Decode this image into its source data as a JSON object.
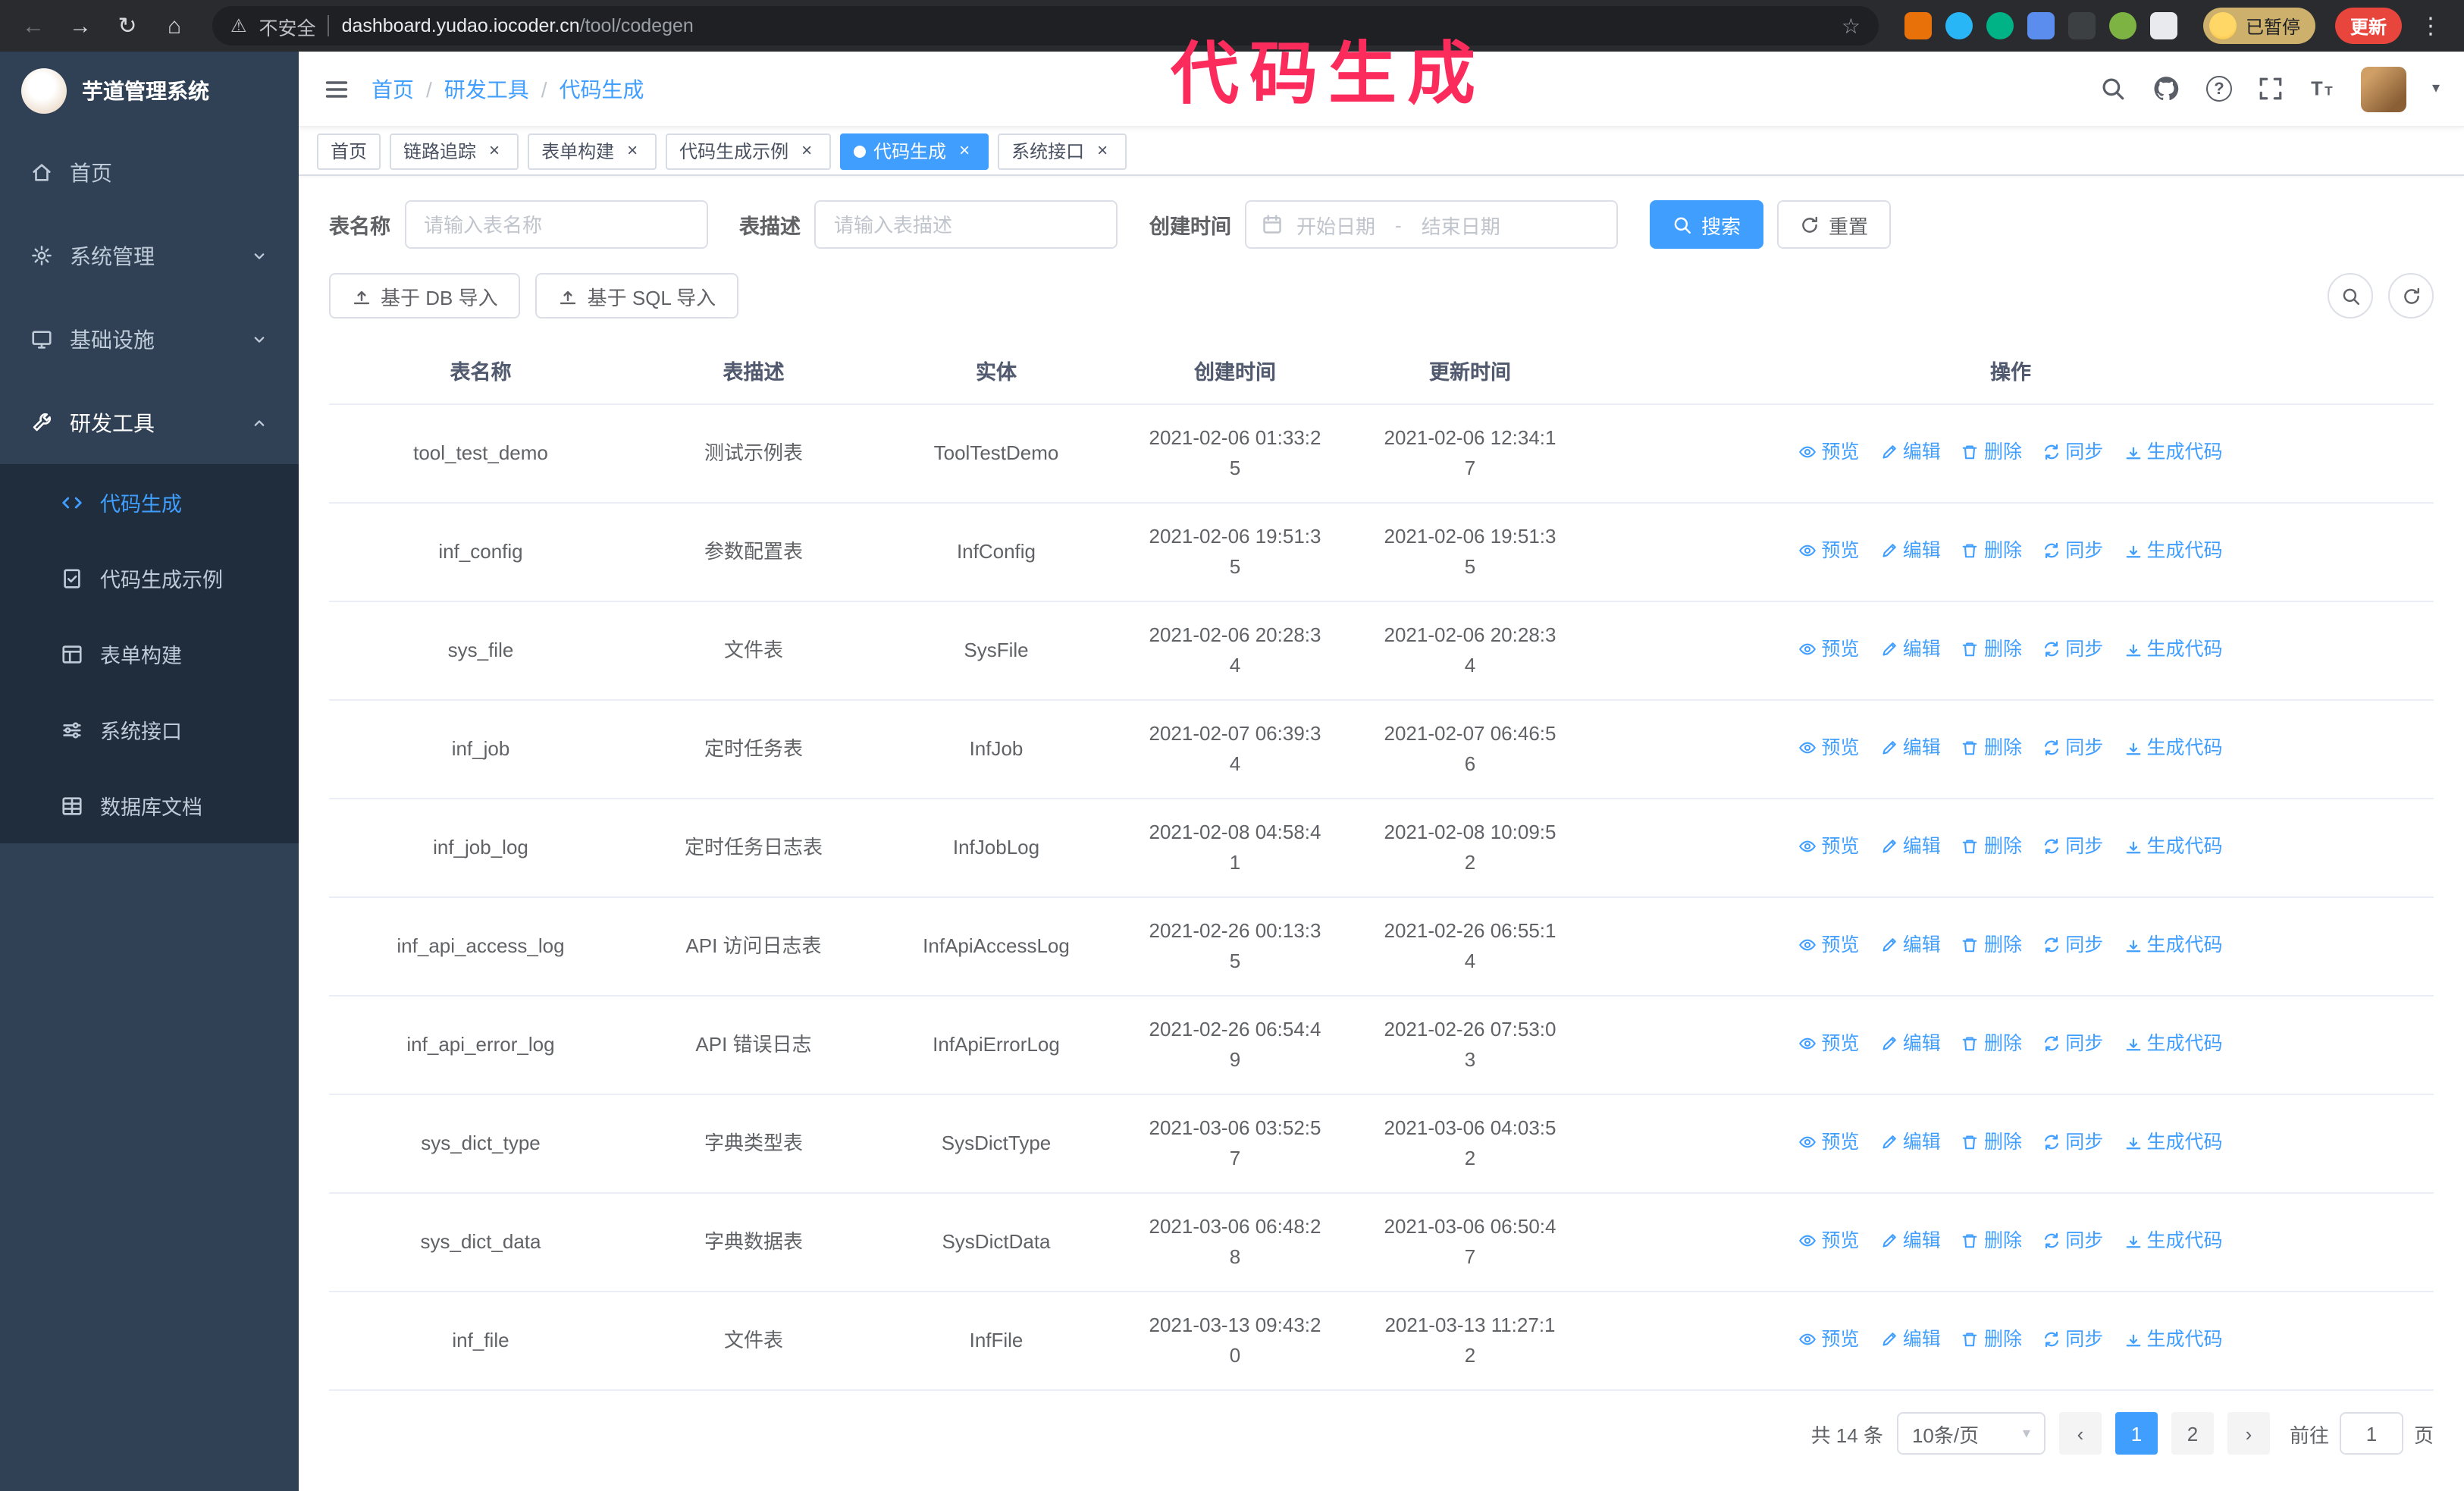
{
  "annotation": {
    "text": "代码生成",
    "color": "#fb2c5c"
  },
  "browser": {
    "insecure_label": "不安全",
    "url_domain": "dashboard.yudao.iocoder.cn",
    "url_path": "/tool/codegen",
    "paused_badge": "已暂停",
    "update_button": "更新"
  },
  "icons": {
    "back": "←",
    "forward": "→",
    "reload": "↻",
    "home": "⌂",
    "warning": "⚠",
    "star": "☆",
    "menu": "⋮",
    "close": "×",
    "caret_down": "▾",
    "question": "?",
    "prev": "‹",
    "next": "›",
    "breadcrumb_sep": "/"
  },
  "sidebar": {
    "logo_title": "芋道管理系统",
    "items": [
      {
        "label": "首页"
      },
      {
        "label": "系统管理"
      },
      {
        "label": "基础设施"
      },
      {
        "label": "研发工具"
      }
    ],
    "submenu": [
      {
        "label": "代码生成",
        "active": true
      },
      {
        "label": "代码生成示例"
      },
      {
        "label": "表单构建"
      },
      {
        "label": "系统接口"
      },
      {
        "label": "数据库文档"
      }
    ]
  },
  "header": {
    "breadcrumb": [
      "首页",
      "研发工具",
      "代码生成"
    ]
  },
  "tabs": [
    {
      "label": "首页",
      "closable": false,
      "active": false
    },
    {
      "label": "链路追踪",
      "closable": true,
      "active": false
    },
    {
      "label": "表单构建",
      "closable": true,
      "active": false
    },
    {
      "label": "代码生成示例",
      "closable": true,
      "active": false
    },
    {
      "label": "代码生成",
      "closable": true,
      "active": true
    },
    {
      "label": "系统接口",
      "closable": true,
      "active": false
    }
  ],
  "filters": {
    "table_name_label": "表名称",
    "table_name_placeholder": "请输入表名称",
    "table_desc_label": "表描述",
    "table_desc_placeholder": "请输入表描述",
    "create_time_label": "创建时间",
    "date_start_placeholder": "开始日期",
    "date_separator": "-",
    "date_end_placeholder": "结束日期",
    "search_button": "搜索",
    "reset_button": "重置"
  },
  "toolbar": {
    "import_db_button": "基于 DB 导入",
    "import_sql_button": "基于 SQL 导入"
  },
  "table": {
    "columns": [
      "表名称",
      "表描述",
      "实体",
      "创建时间",
      "更新时间",
      "操作"
    ],
    "ops": {
      "preview": "预览",
      "edit": "编辑",
      "delete": "删除",
      "sync": "同步",
      "generate": "生成代码"
    },
    "rows": [
      {
        "name": "tool_test_demo",
        "desc": "测试示例表",
        "entity": "ToolTestDemo",
        "created": "2021-02-06 01:33:25",
        "updated": "2021-02-06 12:34:17"
      },
      {
        "name": "inf_config",
        "desc": "参数配置表",
        "entity": "InfConfig",
        "created": "2021-02-06 19:51:35",
        "updated": "2021-02-06 19:51:35"
      },
      {
        "name": "sys_file",
        "desc": "文件表",
        "entity": "SysFile",
        "created": "2021-02-06 20:28:34",
        "updated": "2021-02-06 20:28:34"
      },
      {
        "name": "inf_job",
        "desc": "定时任务表",
        "entity": "InfJob",
        "created": "2021-02-07 06:39:34",
        "updated": "2021-02-07 06:46:56"
      },
      {
        "name": "inf_job_log",
        "desc": "定时任务日志表",
        "entity": "InfJobLog",
        "created": "2021-02-08 04:58:41",
        "updated": "2021-02-08 10:09:52"
      },
      {
        "name": "inf_api_access_log",
        "desc": "API 访问日志表",
        "entity": "InfApiAccessLog",
        "created": "2021-02-26 00:13:35",
        "updated": "2021-02-26 06:55:14"
      },
      {
        "name": "inf_api_error_log",
        "desc": "API 错误日志",
        "entity": "InfApiErrorLog",
        "created": "2021-02-26 06:54:49",
        "updated": "2021-02-26 07:53:03"
      },
      {
        "name": "sys_dict_type",
        "desc": "字典类型表",
        "entity": "SysDictType",
        "created": "2021-03-06 03:52:57",
        "updated": "2021-03-06 04:03:52"
      },
      {
        "name": "sys_dict_data",
        "desc": "字典数据表",
        "entity": "SysDictData",
        "created": "2021-03-06 06:48:28",
        "updated": "2021-03-06 06:50:47"
      },
      {
        "name": "inf_file",
        "desc": "文件表",
        "entity": "InfFile",
        "created": "2021-03-13 09:43:20",
        "updated": "2021-03-13 11:27:12"
      }
    ]
  },
  "pagination": {
    "total_label": "共 14 条",
    "page_size": "10条/页",
    "pages": [
      "1",
      "2"
    ],
    "active_page": "1",
    "goto_label": "前往",
    "goto_value": "1",
    "goto_suffix": "页"
  },
  "colors": {
    "primary": "#409eff",
    "annotation": "#fb2c5c",
    "sidebar_bg": "#304156",
    "submenu_bg": "#1f2d3d",
    "update_button_bg": "#e8453c",
    "paused_badge_bg": "#cdb06b"
  }
}
